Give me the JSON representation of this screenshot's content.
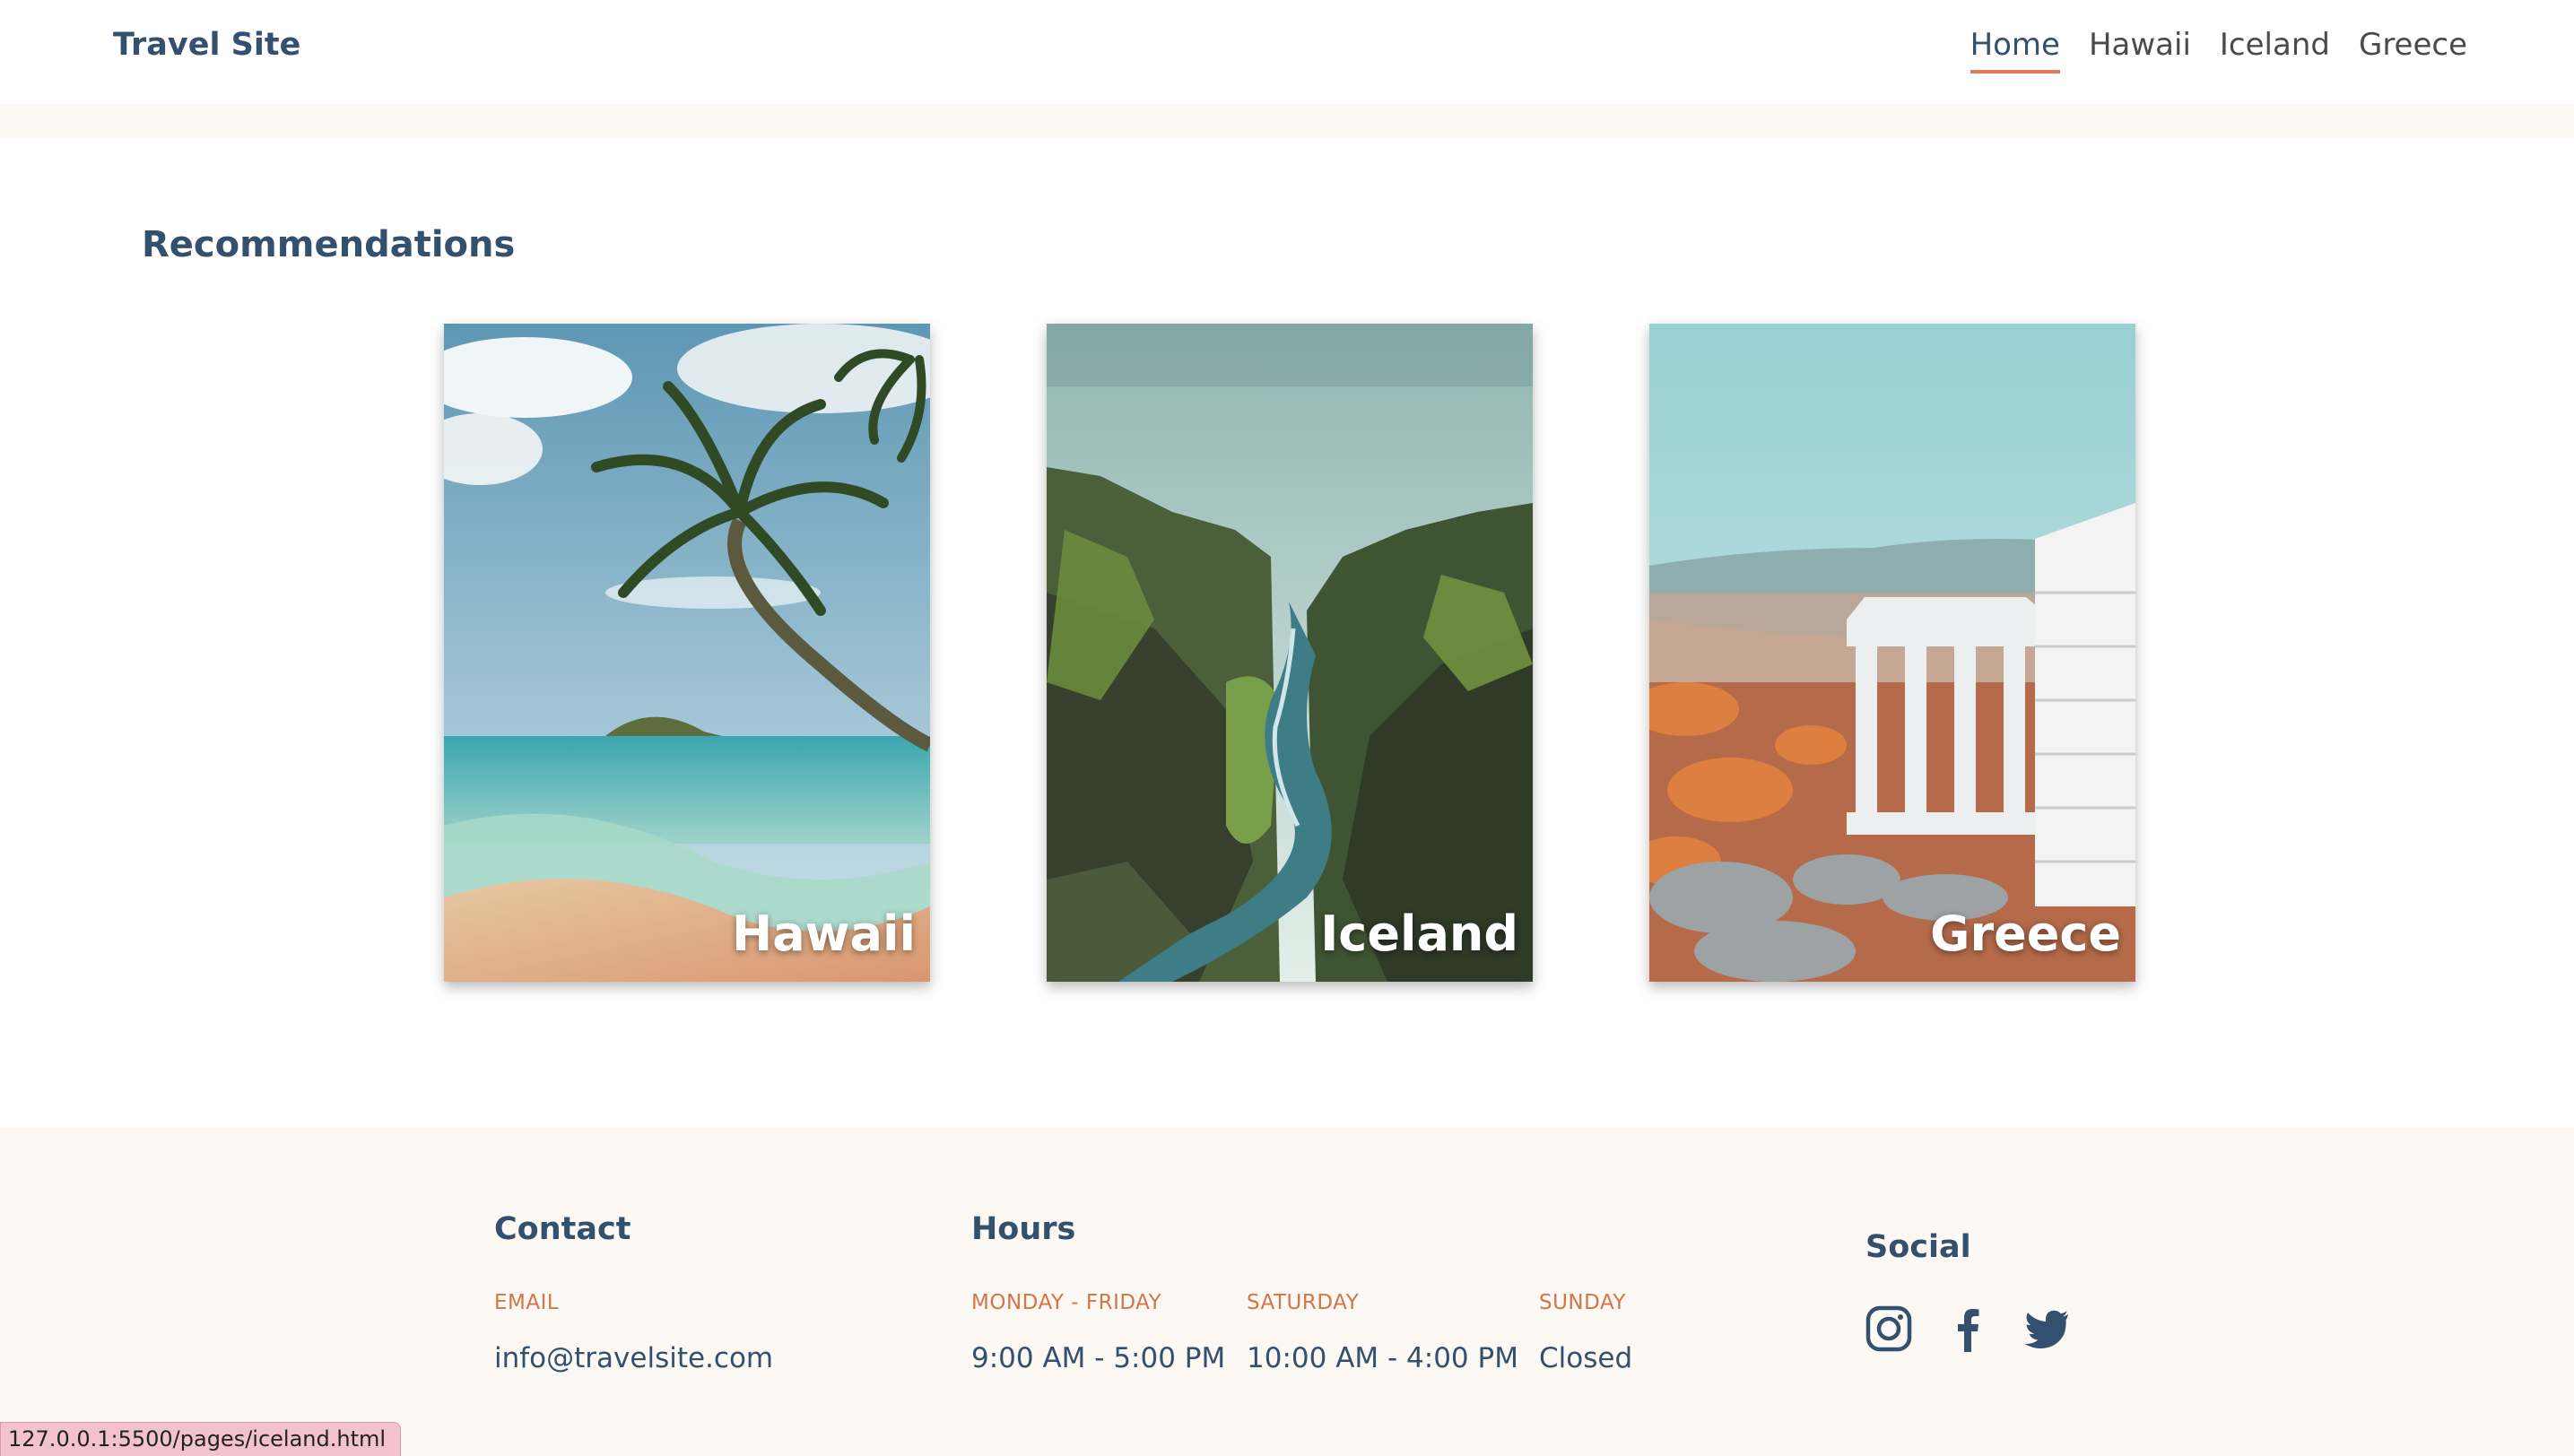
{
  "header": {
    "logo": "Travel Site",
    "nav": [
      "Home",
      "Hawaii",
      "Iceland",
      "Greece"
    ],
    "active": "Home",
    "accent_color": "#e07b57"
  },
  "recommendations": {
    "title": "Recommendations",
    "cards": [
      {
        "label": "Hawaii",
        "image": "beach-palm-photo"
      },
      {
        "label": "Iceland",
        "image": "canyon-river-photo"
      },
      {
        "label": "Greece",
        "image": "temple-ruins-photo"
      }
    ]
  },
  "footer": {
    "contact": {
      "heading": "Contact",
      "email_label": "EMAIL",
      "email": "info@travelsite.com"
    },
    "hours": {
      "heading": "Hours",
      "slots": [
        {
          "label": "MONDAY - FRIDAY",
          "value": "9:00 AM - 5:00 PM"
        },
        {
          "label": "SATURDAY",
          "value": "10:00 AM - 4:00 PM"
        },
        {
          "label": "SUNDAY",
          "value": "Closed"
        }
      ]
    },
    "social": {
      "heading": "Social",
      "icons": [
        "instagram-icon",
        "facebook-icon",
        "twitter-icon"
      ]
    }
  },
  "status_bar": {
    "url": "127.0.0.1:5500/pages/iceland.html"
  }
}
